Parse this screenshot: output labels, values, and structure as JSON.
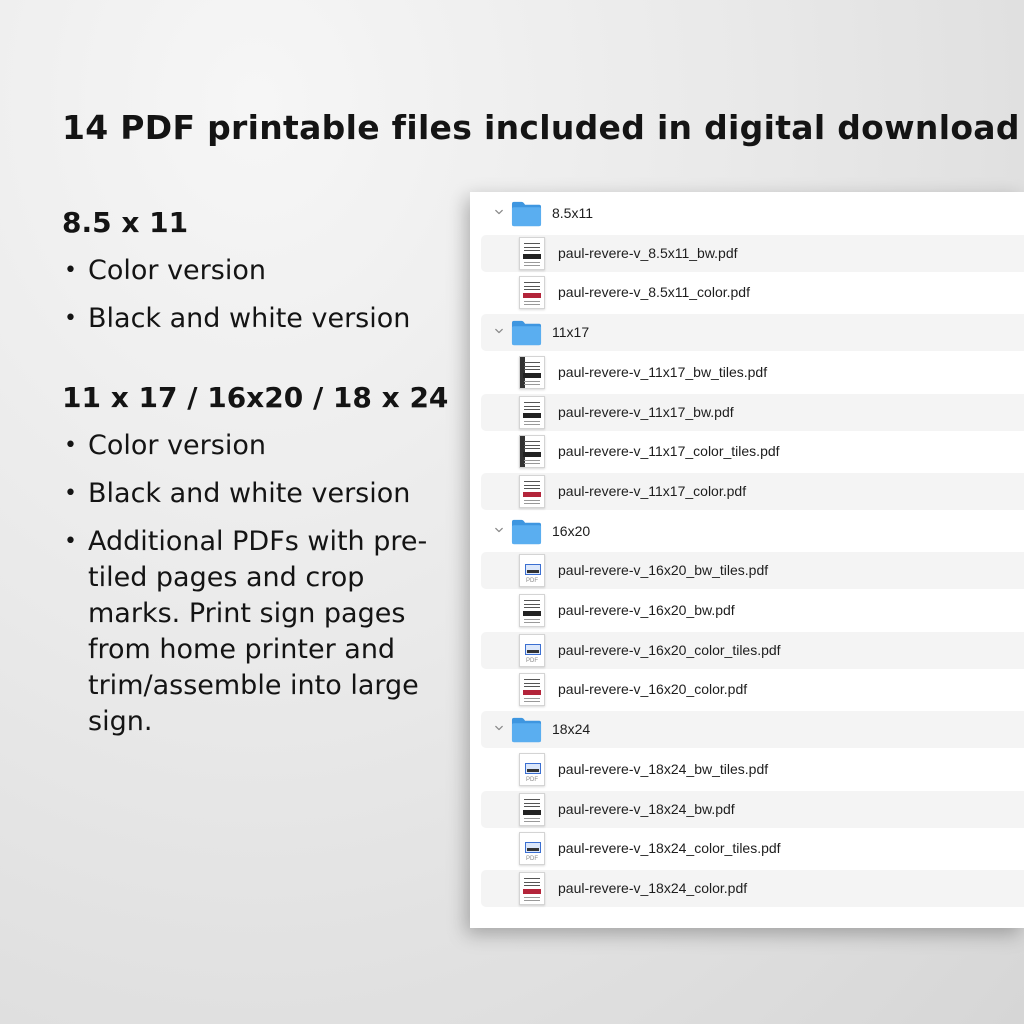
{
  "headline": "14 PDF printable files included in digital download",
  "sections": [
    {
      "title": "8.5 x 11",
      "bullets": [
        "Color version",
        "Black and white version"
      ]
    },
    {
      "title": "11 x 17 / 16x20 / 18 x 24",
      "bullets": [
        "Color version",
        "Black and white version",
        "Additional PDFs with pre-tiled pages and crop marks. Print sign pages from home printer and trim/assemble into large sign."
      ]
    }
  ],
  "finder": {
    "rows": [
      {
        "kind": "folder",
        "name": "8.5x11",
        "icon": "folder-icon"
      },
      {
        "kind": "file",
        "name": "paul-revere-v_8.5x11_bw.pdf",
        "thumb": "bw"
      },
      {
        "kind": "file",
        "name": "paul-revere-v_8.5x11_color.pdf",
        "thumb": "color"
      },
      {
        "kind": "folder",
        "name": "11x17",
        "icon": "folder-icon"
      },
      {
        "kind": "file",
        "name": "paul-revere-v_11x17_bw_tiles.pdf",
        "thumb": "bwtile"
      },
      {
        "kind": "file",
        "name": "paul-revere-v_11x17_bw.pdf",
        "thumb": "bw"
      },
      {
        "kind": "file",
        "name": "paul-revere-v_11x17_color_tiles.pdf",
        "thumb": "bwtile"
      },
      {
        "kind": "file",
        "name": "paul-revere-v_11x17_color.pdf",
        "thumb": "color"
      },
      {
        "kind": "folder",
        "name": "16x20",
        "icon": "folder-icon"
      },
      {
        "kind": "file",
        "name": "paul-revere-v_16x20_bw_tiles.pdf",
        "thumb": "tile"
      },
      {
        "kind": "file",
        "name": "paul-revere-v_16x20_bw.pdf",
        "thumb": "bw"
      },
      {
        "kind": "file",
        "name": "paul-revere-v_16x20_color_tiles.pdf",
        "thumb": "tile"
      },
      {
        "kind": "file",
        "name": "paul-revere-v_16x20_color.pdf",
        "thumb": "color"
      },
      {
        "kind": "folder",
        "name": "18x24",
        "icon": "folder-icon"
      },
      {
        "kind": "file",
        "name": "paul-revere-v_18x24_bw_tiles.pdf",
        "thumb": "tile"
      },
      {
        "kind": "file",
        "name": "paul-revere-v_18x24_bw.pdf",
        "thumb": "bw"
      },
      {
        "kind": "file",
        "name": "paul-revere-v_18x24_color_tiles.pdf",
        "thumb": "tile"
      },
      {
        "kind": "file",
        "name": "paul-revere-v_18x24_color.pdf",
        "thumb": "color"
      }
    ],
    "colors": {
      "folder": "#5aaef0",
      "folder_dark": "#3e96e0",
      "row_alt": "#f4f4f4",
      "chevron": "#8a8a8a"
    }
  }
}
